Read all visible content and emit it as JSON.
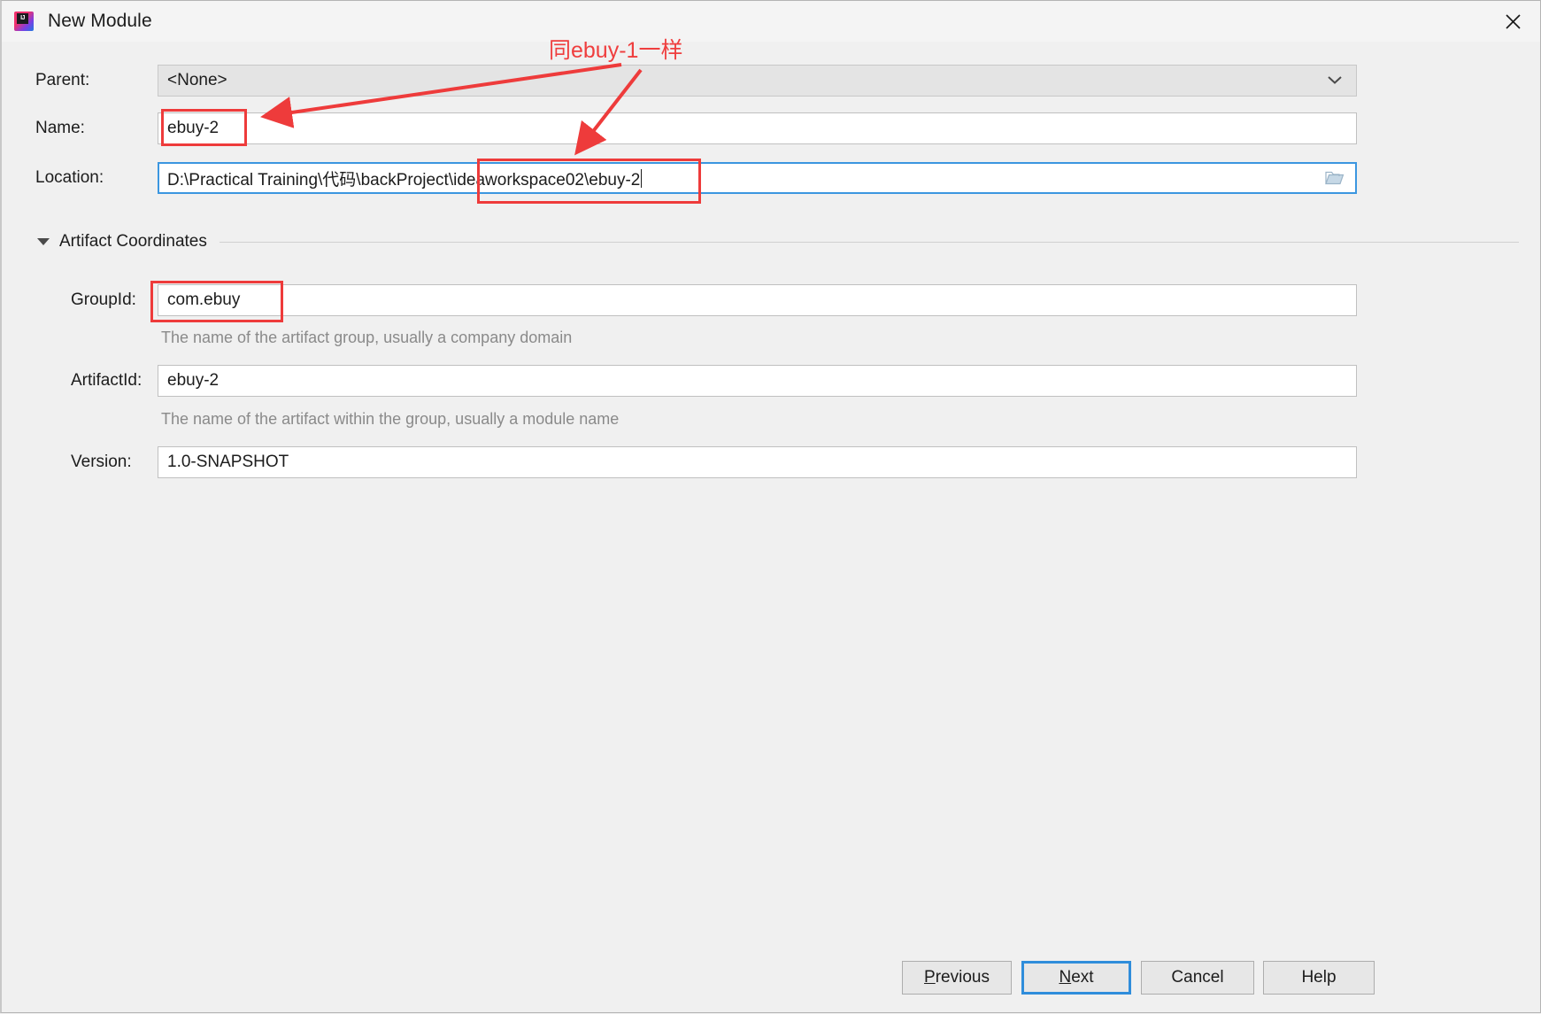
{
  "window": {
    "title": "New Module",
    "app_icon": "intellij-idea-logo",
    "close_icon": "close-icon"
  },
  "form": {
    "parent": {
      "label": "Parent:",
      "value": "<None>",
      "dropdown_icon": "chevron-down-icon"
    },
    "name": {
      "label": "Name:",
      "value": "ebuy-2"
    },
    "location": {
      "label": "Location:",
      "value": "D:\\Practical Training\\代码\\backProject\\ideaworkspace02\\ebuy-2",
      "browse_icon": "folder-icon",
      "focused": true
    }
  },
  "artifact_coordinates": {
    "group_title": "Artifact Coordinates",
    "expanded": true,
    "collapse_icon": "triangle-down-icon",
    "group_id": {
      "label": "GroupId:",
      "value": "com.ebuy",
      "hint": "The name of the artifact group, usually a company domain"
    },
    "artifact_id": {
      "label": "ArtifactId:",
      "value": "ebuy-2",
      "hint": "The name of the artifact within the group, usually a module name"
    },
    "version": {
      "label": "Version:",
      "value": "1.0-SNAPSHOT"
    }
  },
  "buttons": {
    "previous": {
      "mnemonic": "P",
      "rest": "revious"
    },
    "next": {
      "mnemonic": "N",
      "rest": "ext",
      "focused": true
    },
    "cancel": {
      "label": "Cancel"
    },
    "help": {
      "label": "Help"
    }
  },
  "annotations": {
    "same_as_ebuy1": "同ebuy-1一样",
    "color": "#ee3b3b",
    "highlight_boxes": [
      "name-field",
      "location-path-tail",
      "groupid-field"
    ],
    "arrows": [
      "arrow-to-name-field",
      "arrow-to-location-path"
    ]
  }
}
